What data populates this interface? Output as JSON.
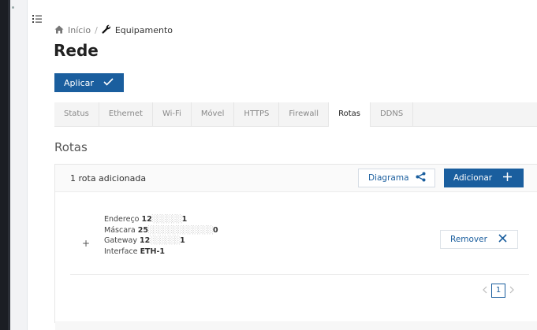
{
  "breadcrumb": {
    "home": "Início",
    "separator": "/",
    "current": "Equipamento"
  },
  "page": {
    "title": "Rede"
  },
  "toolbar": {
    "apply_label": "Aplicar"
  },
  "tabs": [
    {
      "label": "Status"
    },
    {
      "label": "Ethernet"
    },
    {
      "label": "Wi-Fi"
    },
    {
      "label": "Móvel"
    },
    {
      "label": "HTTPS"
    },
    {
      "label": "Firewall"
    },
    {
      "label": "Rotas",
      "active": true
    },
    {
      "label": "DDNS"
    }
  ],
  "section": {
    "title": "Rotas"
  },
  "routes_card": {
    "count_label": "1 rota adicionada",
    "diagram_label": "Diagrama",
    "add_label": "Adicionar",
    "route": {
      "expand_symbol": "+",
      "address_label": "Endereço",
      "address_value": "12",
      "address_suffix": "1",
      "mask_label": "Máscara",
      "mask_value": "25",
      "mask_suffix": "0",
      "gateway_label": "Gateway",
      "gateway_value": "12",
      "gateway_suffix": "1",
      "interface_label": "Interface",
      "interface_value": "ETH-1",
      "remove_label": "Remover"
    }
  },
  "pagination": {
    "current_page": "1"
  },
  "colors": {
    "accent": "#1a5e9e",
    "sidebar_dark": "#1b1e24",
    "tab_bar": "#f4f4f4"
  },
  "icons": [
    "menu-icon",
    "home-icon",
    "wrench-icon",
    "check-icon",
    "share-icon",
    "plus-icon",
    "close-icon",
    "chevron-left-icon",
    "chevron-right-icon"
  ]
}
